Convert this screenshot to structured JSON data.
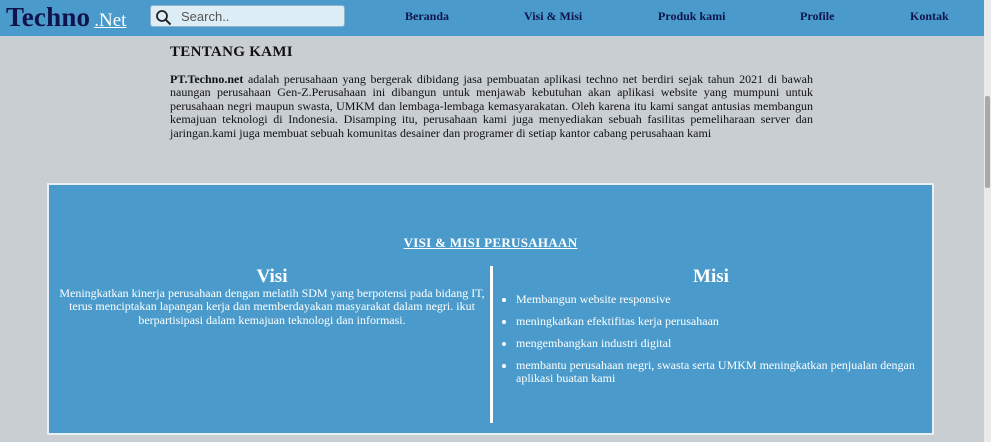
{
  "navbar": {
    "logo_main": "Techno",
    "logo_sub": ".Net",
    "search_placeholder": "Search..",
    "links": [
      "Beranda",
      "Visi & Misi",
      "Produk kami",
      "Profile",
      "Kontak"
    ]
  },
  "about": {
    "title": "TENTANG KAMI",
    "company": "PT.Techno.net",
    "text": " adalah perusahaan yang bergerak dibidang jasa pembuatan aplikasi techno net berdiri sejak tahun 2021 di bawah naungan perusahaan Gen-Z.Perusahaan ini dibangun untuk menjawab kebutuhan akan aplikasi website yang mumpuni untuk perusahaan negri maupun swasta, UMKM dan lembaga-lembaga kemasyarakatan. Oleh karena itu kami sangat antusias membangun kemajuan teknologi di Indonesia. Disamping itu, perusahaan kami juga menyediakan sebuah fasilitas pemeliharaan server dan jaringan.kami juga membuat sebuah komunitas desainer dan programer di setiap kantor cabang perusahaan kami"
  },
  "visi_misi": {
    "title": "VISI & MISI PERUSAHAAN",
    "visi_heading": "Visi",
    "visi_text": "Meningkatkan kinerja perusahaan dengan melatih SDM yang berpotensi pada bidang IT, terus menciptakan lapangan kerja dan memberdayakan masyarakat dalam negri. ikut berpartisipasi dalam kemajuan teknologi dan informasi.",
    "misi_heading": "Misi",
    "misi_items": [
      "Membangun website responsive",
      "meningkatkan efektifitas kerja perusahaan",
      "mengembangkan industri digital",
      "membantu perusahaan negri, swasta serta UMKM meningkatkan penjualan dengan aplikasi buatan kami"
    ]
  },
  "colors": {
    "navbar": "#4a9bcb",
    "page_background": "#c9ced2",
    "logo": "#10144d",
    "panel": "#4a9bcb"
  },
  "icons": [
    "search-icon"
  ]
}
